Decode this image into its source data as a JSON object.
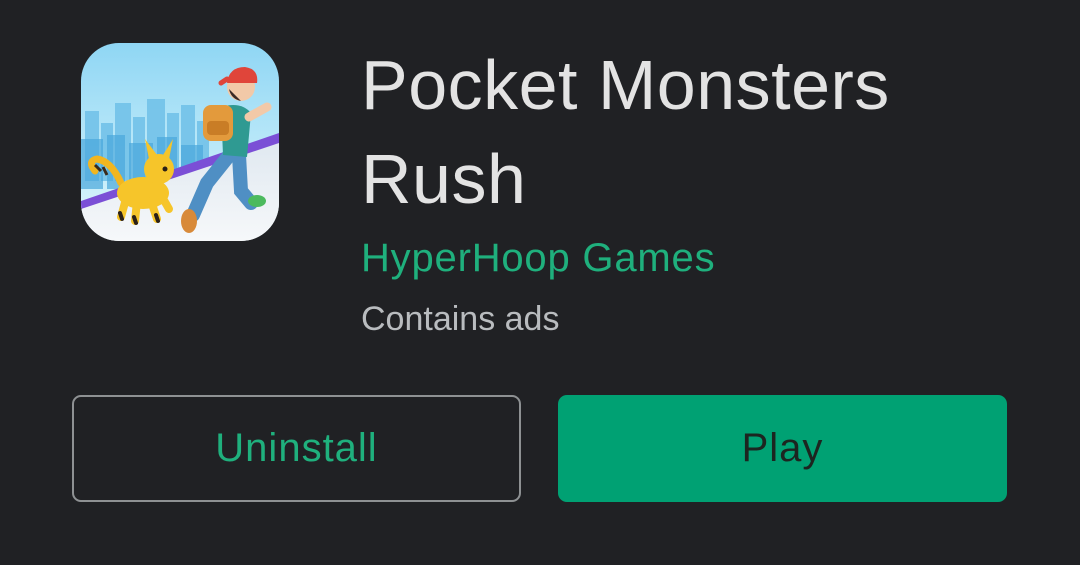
{
  "app": {
    "title": "Pocket Monsters Rush",
    "developer": "HyperHoop Games",
    "ads_note": "Contains ads",
    "icon": "game-icon-trainer-and-yellow-creature-running"
  },
  "actions": {
    "uninstall_label": "Uninstall",
    "play_label": "Play"
  },
  "colors": {
    "background": "#202124",
    "accent_green": "#00a173",
    "developer_text": "#1fb07d",
    "title_text": "#e3e3e3",
    "secondary_text": "#b9bcbf",
    "outline": "#8e9193"
  }
}
